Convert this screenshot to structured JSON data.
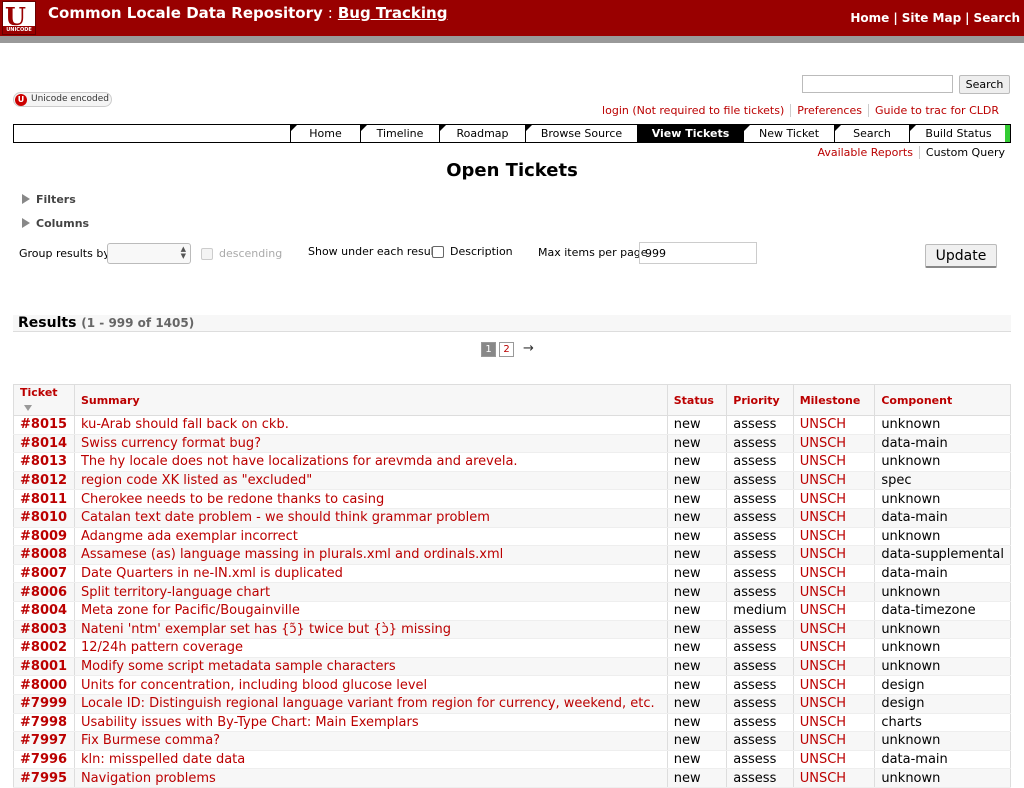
{
  "banner": {
    "logo_text": "U",
    "logo_sub": "UNICODE",
    "title": "Common Locale Data Repository",
    "title_sep": ":",
    "subtitle": "Bug Tracking",
    "links": [
      "Home",
      "Site Map",
      "Search"
    ],
    "link_sep": "|"
  },
  "search": {
    "placeholder": "",
    "button_label": "Search"
  },
  "badge": {
    "icon": "U",
    "label": "Unicode encoded"
  },
  "meta_nav": [
    "login (Not required to file tickets)",
    "Preferences",
    "Guide to trac for CLDR"
  ],
  "main_nav": {
    "tabs": [
      "Home",
      "Timeline",
      "Roadmap",
      "Browse Source",
      "View Tickets",
      "New Ticket",
      "Search",
      "Build Status"
    ],
    "active": "View Tickets"
  },
  "context_nav": [
    "Available Reports",
    "Custom Query"
  ],
  "page_title": "Open Tickets",
  "filters_label": "Filters",
  "columns_label": "Columns",
  "controls": {
    "group_label": "Group results by",
    "group_value": "",
    "descending_label": "descending",
    "show_label": "Show under each result:",
    "description_label": "Description",
    "max_label": "Max items per page",
    "max_value": "999",
    "update_label": "Update"
  },
  "results": {
    "title": "Results",
    "count": "(1 - 999 of 1405)"
  },
  "paging": {
    "pages": [
      "1",
      "2"
    ],
    "current": "1",
    "next": "→"
  },
  "table": {
    "headers": [
      "Ticket",
      "Summary",
      "Status",
      "Priority",
      "Milestone",
      "Component"
    ],
    "rows": [
      [
        "#8015",
        "ku-Arab should fall back on ckb.",
        "new",
        "assess",
        "UNSCH",
        "unknown"
      ],
      [
        "#8014",
        "Swiss currency format bug?",
        "new",
        "assess",
        "UNSCH",
        "data-main"
      ],
      [
        "#8013",
        "The hy locale does not have localizations for arevmda and arevela.",
        "new",
        "assess",
        "UNSCH",
        "unknown"
      ],
      [
        "#8012",
        "region code XK listed as \"excluded\"",
        "new",
        "assess",
        "UNSCH",
        "spec"
      ],
      [
        "#8011",
        "Cherokee needs to be redone thanks to casing",
        "new",
        "assess",
        "UNSCH",
        "unknown"
      ],
      [
        "#8010",
        "Catalan text date problem - we should think grammar problem",
        "new",
        "assess",
        "UNSCH",
        "data-main"
      ],
      [
        "#8009",
        "Adangme ada exemplar incorrect",
        "new",
        "assess",
        "UNSCH",
        "unknown"
      ],
      [
        "#8008",
        "Assamese (as) language massing in plurals.xml and ordinals.xml",
        "new",
        "assess",
        "UNSCH",
        "data-supplemental"
      ],
      [
        "#8007",
        "Date Quarters in ne-IN.xml is duplicated",
        "new",
        "assess",
        "UNSCH",
        "data-main"
      ],
      [
        "#8006",
        "Split territory-language chart",
        "new",
        "assess",
        "UNSCH",
        "unknown"
      ],
      [
        "#8004",
        "Meta zone for Pacific/Bougainville",
        "new",
        "medium",
        "UNSCH",
        "data-timezone"
      ],
      [
        "#8003",
        "Nateni 'ntm' exemplar set has {ɔ̃} twice but {ɔ̀} missing",
        "new",
        "assess",
        "UNSCH",
        "unknown"
      ],
      [
        "#8002",
        "12/24h pattern coverage",
        "new",
        "assess",
        "UNSCH",
        "unknown"
      ],
      [
        "#8001",
        "Modify some script metadata sample characters",
        "new",
        "assess",
        "UNSCH",
        "unknown"
      ],
      [
        "#8000",
        "Units for concentration, including blood glucose level",
        "new",
        "assess",
        "UNSCH",
        "design"
      ],
      [
        "#7999",
        "Locale ID: Distinguish regional language variant from region for currency, weekend, etc.",
        "new",
        "assess",
        "UNSCH",
        "design"
      ],
      [
        "#7998",
        "Usability issues with By-Type Chart: Main Exemplars",
        "new",
        "assess",
        "UNSCH",
        "charts"
      ],
      [
        "#7997",
        "Fix Burmese comma?",
        "new",
        "assess",
        "UNSCH",
        "unknown"
      ],
      [
        "#7996",
        "kln: misspelled date data",
        "new",
        "assess",
        "UNSCH",
        "data-main"
      ],
      [
        "#7995",
        "Navigation problems",
        "new",
        "assess",
        "UNSCH",
        "unknown"
      ]
    ]
  },
  "colors": {
    "brand": "#990000",
    "link": "#bb0000",
    "build_ok": "#33cc33"
  }
}
